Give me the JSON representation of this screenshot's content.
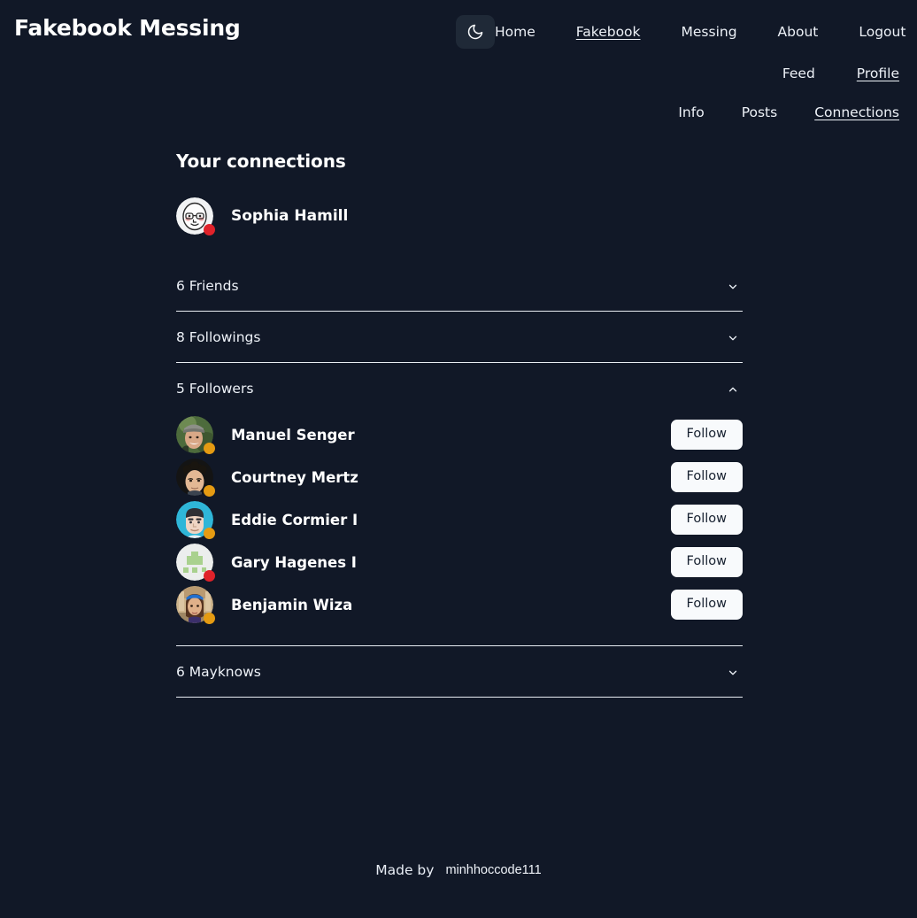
{
  "header": {
    "brand": "Fakebook Messing",
    "theme_toggle": {
      "icon": "moon-icon",
      "label": ""
    },
    "nav_primary": [
      {
        "label": "Home",
        "active": false
      },
      {
        "label": "Fakebook",
        "active": true
      },
      {
        "label": "Messing",
        "active": false
      },
      {
        "label": "About",
        "active": false
      },
      {
        "label": "Logout",
        "active": false
      }
    ],
    "nav_secondary": [
      {
        "label": "Feed",
        "active": false
      },
      {
        "label": "Profile",
        "active": true
      }
    ],
    "nav_tertiary": [
      {
        "label": "Info",
        "active": false
      },
      {
        "label": "Posts",
        "active": false
      },
      {
        "label": "Connections",
        "active": true
      }
    ]
  },
  "main": {
    "title": "Your connections",
    "owner": {
      "name": "Sophia Hamill",
      "avatar": "cartoon-face-glasses-avatar",
      "status": "red"
    },
    "sections": [
      {
        "label": "6 Friends",
        "count": 6,
        "expanded": false,
        "chevron": "chevron-down-icon",
        "people": []
      },
      {
        "label": "8 Followings",
        "count": 8,
        "expanded": false,
        "chevron": "chevron-down-icon",
        "people": []
      },
      {
        "label": "5 Followers",
        "count": 5,
        "expanded": true,
        "chevron": "chevron-up-icon",
        "people": [
          {
            "name": "Manuel Senger",
            "avatar": "photo-man-cap",
            "status": "amber",
            "action": "Follow"
          },
          {
            "name": "Courtney Mertz",
            "avatar": "photo-man-curly-hair",
            "status": "amber",
            "action": "Follow"
          },
          {
            "name": "Eddie Cormier I",
            "avatar": "illustration-man-cyan-bg",
            "status": "amber",
            "action": "Follow"
          },
          {
            "name": "Gary Hagenes I",
            "avatar": "identicon-green-gray-bg",
            "status": "red",
            "action": "Follow"
          },
          {
            "name": "Benjamin Wiza",
            "avatar": "photo-woman-blue-headband",
            "status": "amber",
            "action": "Follow"
          }
        ]
      },
      {
        "label": "6 Mayknows",
        "count": 6,
        "expanded": false,
        "chevron": "chevron-down-icon",
        "people": []
      }
    ]
  },
  "footer": {
    "made_by": "Made by",
    "author": "minhhoccode111"
  },
  "colors": {
    "background": "#111827",
    "text": "#f3f6fb",
    "divider": "#e9edf3",
    "toggle_bg": "#1f2937",
    "button_bg": "#f8fafc",
    "button_text": "#16202f",
    "status_red": "#e0222a",
    "status_amber": "#e59b12"
  }
}
